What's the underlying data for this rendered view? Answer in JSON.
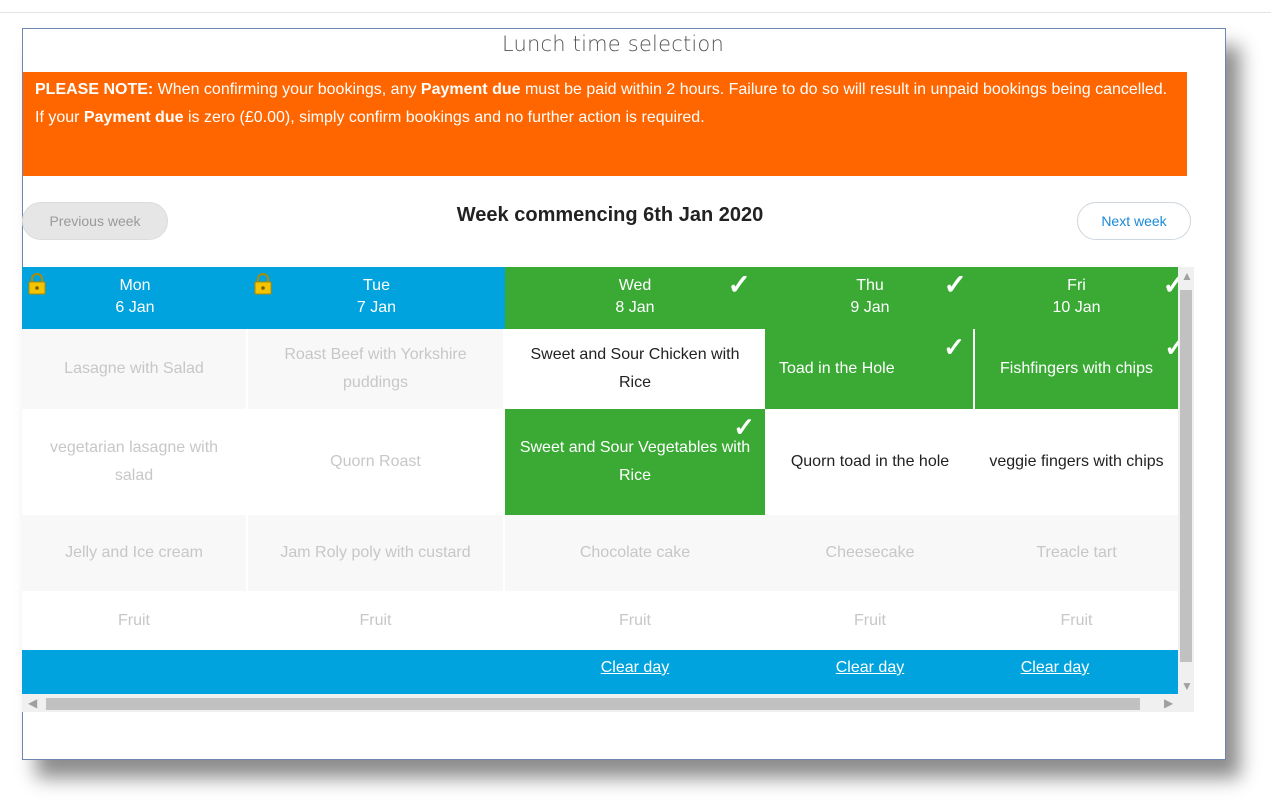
{
  "title": "Lunch time selection",
  "notice": {
    "line1_prefix": "PLEASE NOTE:",
    "line1_a": " When confirming your bookings, any ",
    "line1_bold": "Payment due",
    "line1_b": " must be paid within 2 hours. Failure to do so will result in unpaid bookings being cancelled.",
    "line2_a": "If your ",
    "line2_bold": "Payment due",
    "line2_b": " is zero (£0.00), simply confirm bookings and no further action is required."
  },
  "nav": {
    "prev_label": "Previous week",
    "week_title": "Week commencing 6th Jan 2020",
    "next_label": "Next week"
  },
  "days": [
    {
      "day": "Mon",
      "date": "6 Jan",
      "locked": true,
      "confirmed": false
    },
    {
      "day": "Tue",
      "date": "7 Jan",
      "locked": true,
      "confirmed": false
    },
    {
      "day": "Wed",
      "date": "8 Jan",
      "locked": false,
      "confirmed": true
    },
    {
      "day": "Thu",
      "date": "9 Jan",
      "locked": false,
      "confirmed": true
    },
    {
      "day": "Fri",
      "date": "10 Jan",
      "locked": false,
      "confirmed": true
    }
  ],
  "rows": {
    "main": [
      "Lasagne with Salad",
      "Roast Beef with Yorkshire puddings",
      "Sweet and Sour Chicken with Rice",
      "Toad in the Hole",
      "Fishfingers with chips"
    ],
    "veg": [
      "vegetarian lasagne with salad",
      "Quorn Roast",
      "Sweet and Sour Vegetables with Rice",
      "Quorn toad in the hole",
      "veggie fingers with chips"
    ],
    "dessert": [
      "Jelly and Ice cream",
      "Jam Roly poly with custard",
      "Chocolate cake",
      "Cheesecake",
      "Treacle tart"
    ],
    "fruit": [
      "Fruit",
      "Fruit",
      "Fruit",
      "Fruit",
      "Fruit"
    ]
  },
  "clear_label": "Clear day",
  "colors": {
    "notice": "#ff6600",
    "header_blue": "#00a3dd",
    "selected_green": "#3aaa35",
    "next_link": "#1a8ad8"
  }
}
